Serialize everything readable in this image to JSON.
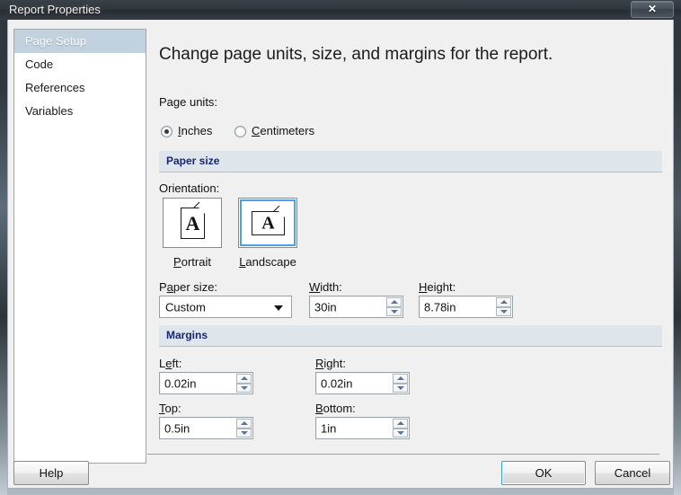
{
  "window": {
    "title": "Report Properties",
    "close_label": "✕",
    "close_icon": "close-icon"
  },
  "sidebar": {
    "items": [
      {
        "label": "Page Setup",
        "selected": true
      },
      {
        "label": "Code",
        "selected": false
      },
      {
        "label": "References",
        "selected": false
      },
      {
        "label": "Variables",
        "selected": false
      }
    ]
  },
  "main": {
    "heading": "Change page units, size, and margins for the report.",
    "page_units": {
      "label": "Page units:",
      "options": [
        {
          "label": "Inches",
          "accel": "I",
          "selected": true
        },
        {
          "label": "Centimeters",
          "accel": "C",
          "selected": false
        }
      ]
    },
    "paper_size": {
      "section_title": "Paper size",
      "orientation_label": "Orientation:",
      "orientations": [
        {
          "label": "Portrait",
          "accel": "P",
          "selected": false,
          "icon": "page-portrait-icon"
        },
        {
          "label": "Landscape",
          "accel": "L",
          "selected": true,
          "icon": "page-landscape-icon"
        }
      ],
      "paper_size_label": "Paper size:",
      "paper_size_accel": "a",
      "paper_size_value": "Custom",
      "width_label": "Width:",
      "width_accel": "W",
      "width_value": "30in",
      "height_label": "Height:",
      "height_accel": "H",
      "height_value": "8.78in"
    },
    "margins": {
      "section_title": "Margins",
      "left_label": "Left:",
      "left_accel": "e",
      "left_value": "0.02in",
      "right_label": "Right:",
      "right_accel": "R",
      "right_value": "0.02in",
      "top_label": "Top:",
      "top_accel": "T",
      "top_value": "0.5in",
      "bottom_label": "Bottom:",
      "bottom_accel": "B",
      "bottom_value": "1in"
    }
  },
  "footer": {
    "help_label": "Help",
    "ok_label": "OK",
    "cancel_label": "Cancel"
  },
  "colors": {
    "accent_blue": "#4aa3e8",
    "section_header_text": "#16257a",
    "section_band": "#dee6ec",
    "selection": "#c2d1de",
    "dialog_bg": "#f0f0f0"
  }
}
